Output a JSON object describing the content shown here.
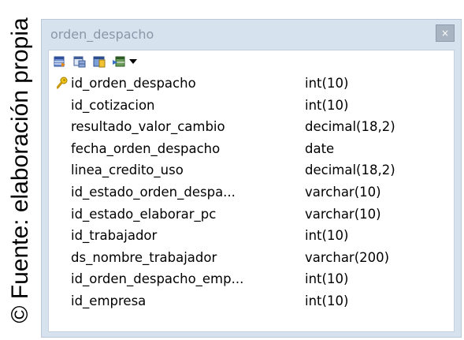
{
  "caption": "© Fuente: elaboración propia",
  "window": {
    "title": "orden_despacho",
    "close_label": "×"
  },
  "toolbar": {
    "buttons": [
      "table-properties-icon",
      "table-design-icon",
      "table-data-icon",
      "table-relations-icon"
    ],
    "dropdown": "chevron-down-icon"
  },
  "columns": [
    {
      "name": "id_orden_despacho",
      "type": "int(10)",
      "primary_key": true
    },
    {
      "name": "id_cotizacion",
      "type": "int(10)",
      "primary_key": false
    },
    {
      "name": "resultado_valor_cambio",
      "type": "decimal(18,2)",
      "primary_key": false
    },
    {
      "name": "fecha_orden_despacho",
      "type": "date",
      "primary_key": false
    },
    {
      "name": "linea_credito_uso",
      "type": "decimal(18,2)",
      "primary_key": false
    },
    {
      "name": "id_estado_orden_despa...",
      "type": "varchar(10)",
      "primary_key": false
    },
    {
      "name": "id_estado_elaborar_pc",
      "type": "varchar(10)",
      "primary_key": false
    },
    {
      "name": "id_trabajador",
      "type": "int(10)",
      "primary_key": false
    },
    {
      "name": "ds_nombre_trabajador",
      "type": "varchar(200)",
      "primary_key": false
    },
    {
      "name": "id_orden_despacho_emp...",
      "type": "int(10)",
      "primary_key": false
    },
    {
      "name": "id_empresa",
      "type": "int(10)",
      "primary_key": false
    }
  ]
}
